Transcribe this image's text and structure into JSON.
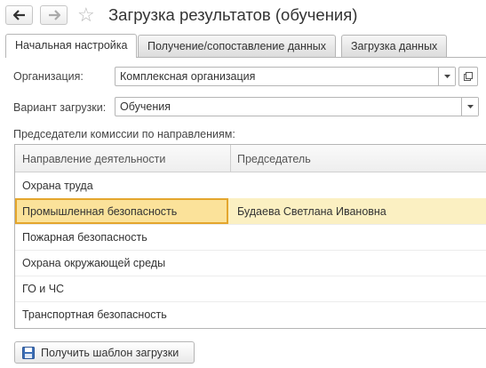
{
  "header": {
    "title": "Загрузка результатов (обучения)"
  },
  "tabs": [
    {
      "label": "Начальная настройка",
      "active": true
    },
    {
      "label": "Получение/сопоставление данных",
      "active": false
    },
    {
      "label": "Загрузка данных",
      "active": false
    }
  ],
  "form": {
    "organization_label": "Организация:",
    "organization_value": "Комплексная организация",
    "load_variant_label": "Вариант загрузки:",
    "load_variant_value": "Обучения",
    "chairmen_section_label": "Председатели комиссии по направлениям:"
  },
  "table": {
    "columns": [
      "Направление деятельности",
      "Председатель"
    ],
    "rows": [
      {
        "direction": "Охрана труда",
        "chairman": ""
      },
      {
        "direction": "Промышленная безопасность",
        "chairman": "Будаева Светлана Ивановна"
      },
      {
        "direction": "Пожарная безопасность",
        "chairman": ""
      },
      {
        "direction": "Охрана окружающей среды",
        "chairman": ""
      },
      {
        "direction": "ГО и ЧС",
        "chairman": ""
      },
      {
        "direction": "Транспортная безопасность",
        "chairman": ""
      }
    ],
    "selected_row": 1
  },
  "footer": {
    "get_template_label": "Получить шаблон загрузки"
  },
  "colors": {
    "selected_row": "#fbf0c2",
    "focused_cell": "#fbe29a",
    "focus_border": "#e4a62d"
  }
}
